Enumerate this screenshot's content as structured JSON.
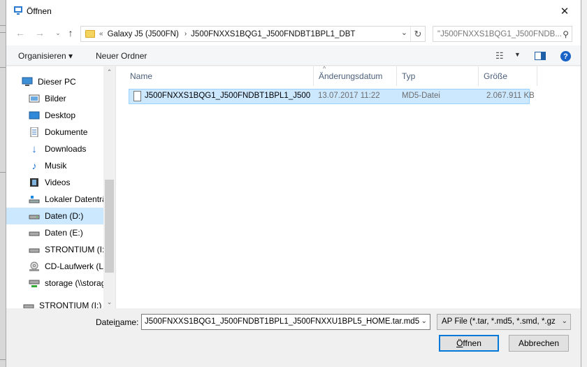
{
  "window": {
    "title": "Öffnen",
    "close_icon": "close-icon"
  },
  "navigation": {
    "address_parts": [
      "Galaxy J5 (J500FN)",
      "J500FNXXS1BQG1_J500FNDBT1BPL1_DBT"
    ],
    "address_overflow": "«",
    "search_placeholder": "\"J500FNXXS1BQG1_J500FNDB...",
    "icons": [
      "back-arrow-icon",
      "forward-arrow-icon",
      "up-arrow-icon",
      "folder-icon",
      "refresh-icon",
      "search-icon"
    ]
  },
  "toolbar": {
    "organize_label": "Organisieren ▾",
    "new_folder_label": "Neuer Ordner"
  },
  "sidebar": {
    "items": [
      {
        "label": "Dieser PC",
        "icon": "computer-icon",
        "level": 0
      },
      {
        "label": "Bilder",
        "icon": "pictures-icon",
        "level": 1
      },
      {
        "label": "Desktop",
        "icon": "desktop-icon",
        "level": 1
      },
      {
        "label": "Dokumente",
        "icon": "documents-icon",
        "level": 1
      },
      {
        "label": "Downloads",
        "icon": "downloads-icon",
        "level": 1
      },
      {
        "label": "Musik",
        "icon": "music-icon",
        "level": 1
      },
      {
        "label": "Videos",
        "icon": "videos-icon",
        "level": 1
      },
      {
        "label": "Lokaler Datenträ",
        "icon": "local-drive-icon",
        "level": 1
      },
      {
        "label": "Daten (D:)",
        "icon": "drive-icon",
        "level": 1,
        "selected": true
      },
      {
        "label": "Daten (E:)",
        "icon": "drive-icon",
        "level": 1
      },
      {
        "label": "STRONTIUM (I:)",
        "icon": "drive-icon",
        "level": 1
      },
      {
        "label": "CD-Laufwerk (L:",
        "icon": "cd-drive-icon",
        "level": 1
      },
      {
        "label": "storage (\\\\storag",
        "icon": "network-drive-icon",
        "level": 1
      },
      {
        "label": "STRONTIUM (I:)",
        "icon": "drive-icon",
        "level": 0
      }
    ]
  },
  "file_list": {
    "columns": [
      "Name",
      "Änderungsdatum",
      "Typ",
      "Größe"
    ],
    "rows": [
      {
        "name": "J500FNXXS1BQG1_J500FNDBT1BPL1_J500...",
        "date": "13.07.2017 11:22",
        "type": "MD5-Datei",
        "size": "2.067.911 KB"
      }
    ]
  },
  "footer": {
    "filename_label_prefix": "Datei",
    "filename_label_underlined": "n",
    "filename_label_suffix": "ame:",
    "filename_value": "J500FNXXS1BQG1_J500FNDBT1BPL1_J500FNXXU1BPL5_HOME.tar.md5",
    "filetype_value": "AP File (*.tar, *.md5, *.smd, *.gz",
    "open_label_prefix": "Ö",
    "open_label_rest": "ffnen",
    "cancel_label": "Abbrechen"
  }
}
